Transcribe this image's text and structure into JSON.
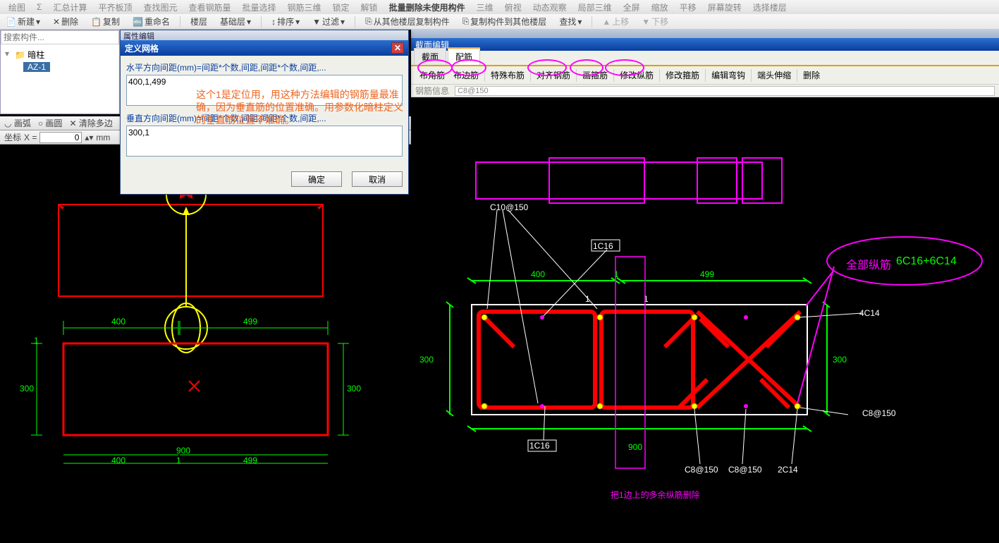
{
  "toolbar1": {
    "items": [
      "绘图",
      "汇总计算",
      "平齐板顶",
      "查找图元",
      "查看钢筋量",
      "批量选择",
      "钢筋三维",
      "锁定",
      "解锁",
      "批量删除未使用构件",
      "三维",
      "俯视",
      "动态观察",
      "局部三维",
      "全屏",
      "缩放",
      "平移",
      "屏幕旋转",
      "选择楼层"
    ]
  },
  "toolbar2": {
    "new": "新建",
    "del": "删除",
    "copy": "复制",
    "rename": "重命名",
    "floor": "楼层",
    "base": "基础层",
    "sort": "排序",
    "filter": "过滤",
    "copyfrom": "从其他楼层复制构件",
    "copyto": "复制构件到其他楼层",
    "find": "查找",
    "up": "上移",
    "down": "下移"
  },
  "left": {
    "search_placeholder": "搜索构件...",
    "tree_root": "暗柱",
    "tree_item": "AZ-1"
  },
  "dialog": {
    "prop_header": "属性编辑",
    "title": "定义网格",
    "h_label": "水平方向间距(mm)=间距*个数,间距,间距*个数,间距,...",
    "h_value": "400,1,499",
    "v_label": "垂直方向间距(mm)=间距*个数,间距,间距*个数,间距,...",
    "v_value": "300,1",
    "ok": "确定",
    "cancel": "取消"
  },
  "annot": {
    "red": "这个1是定位用，用这种方法编辑的钢筋量最准确，因为垂直筋的位置准确。用参数化暗柱定义的垂直筋位置不准确。"
  },
  "ltools": {
    "arc": "画弧",
    "circle": "画圆",
    "clear": "清除多边",
    "coord_label": "坐标",
    "x": "X =",
    "xval": "0",
    "unit": "mm"
  },
  "right": {
    "title": "截面编辑",
    "tabs": [
      "截面",
      "配筋"
    ],
    "subs": [
      "布角筋",
      "布边筋",
      "特殊布筋",
      "对齐钢筋",
      "画箍筋",
      "修改纵筋",
      "修改箍筋",
      "编辑弯钩",
      "端头伸缩",
      "删除"
    ],
    "info_label": "钢筋信息",
    "info_value": "C8@150"
  },
  "labels": {
    "d400": "400",
    "d499": "499",
    "d300": "300",
    "d900": "900",
    "d1": "1",
    "c10": "C10@150",
    "c8": "C8@150",
    "c1c16": "1C16",
    "c4c14": "4C14",
    "c2c14": "2C14",
    "all": "全部纵筋",
    "allv": "6C16+6C14",
    "note": "把1边上的多余纵筋删除"
  }
}
